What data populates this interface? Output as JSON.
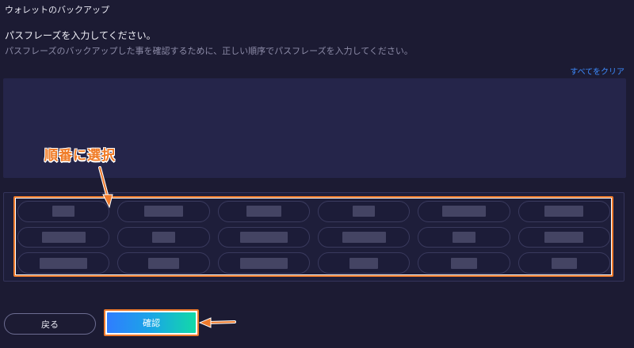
{
  "header": {
    "title": "ウォレットのバックアップ"
  },
  "instructions": {
    "main": "パスフレーズを入力してください。",
    "sub": "パスフレーズのバックアップした事を確認するために、正しい順序でパスフレーズを入力してください。"
  },
  "actions": {
    "clear_all": "すべてをクリア"
  },
  "annotation": {
    "callout": "順番に選択"
  },
  "word_bank": {
    "hidden_fill_fractions": [
      [
        0.25,
        0.43,
        0.38,
        0.25,
        0.48,
        0.43
      ],
      [
        0.48,
        0.25,
        0.52,
        0.48,
        0.25,
        0.43
      ],
      [
        0.52,
        0.34,
        0.52,
        0.32,
        0.29,
        0.28
      ]
    ]
  },
  "footer": {
    "back_label": "戻る",
    "confirm_label": "確認"
  },
  "colors": {
    "background": "#1c1b33",
    "link": "#3d8cff",
    "highlight": "#ef7a2b",
    "confirm_gradient": [
      "#2f7dff",
      "#12d9a8"
    ]
  }
}
